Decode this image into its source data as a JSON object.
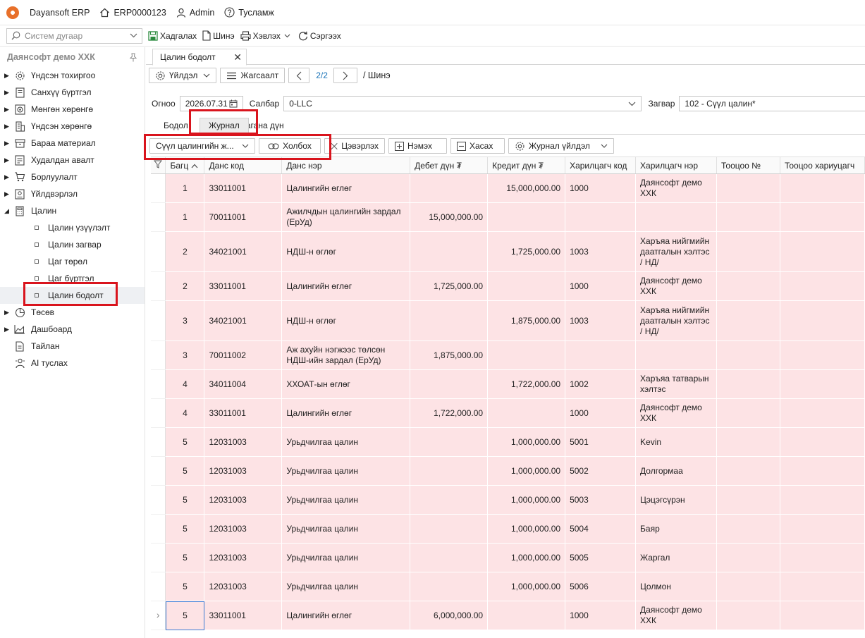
{
  "app": {
    "name": "Dayansoft ERP",
    "code": "ERP0000123",
    "user": "Admin",
    "help": "Тусламж"
  },
  "toolbar": {
    "search_placeholder": "Систем дугаар",
    "save": "Хадгалах",
    "new": "Шинэ",
    "print": "Хэвлэх",
    "refresh": "Сэргээх"
  },
  "sidebar": {
    "company": "Даянсофт демо ХХК",
    "items": [
      {
        "label": "Үндсэн тохиргоо",
        "icon": "gear-icon"
      },
      {
        "label": "Санхүү бүртгэл",
        "icon": "ledger-icon"
      },
      {
        "label": "Мөнгөн хөрөнгө",
        "icon": "cash-icon"
      },
      {
        "label": "Үндсэн хөрөнгө",
        "icon": "building-icon"
      },
      {
        "label": "Бараа материал",
        "icon": "box-icon"
      },
      {
        "label": "Худалдан авалт",
        "icon": "purchase-icon"
      },
      {
        "label": "Борлуулалт",
        "icon": "cart-icon"
      },
      {
        "label": "Үйлдвэрлэл",
        "icon": "factory-icon"
      },
      {
        "label": "Цалин",
        "icon": "calculator-icon"
      }
    ],
    "sub_items": [
      "Цалин үзүүлэлт",
      "Цалин загвар",
      "Цаг төрөл",
      "Цаг бүртгэл",
      "Цалин бодолт"
    ],
    "items_after": [
      {
        "label": "Төсөв",
        "icon": "pie-icon"
      },
      {
        "label": "Дашбоард",
        "icon": "chart-icon"
      },
      {
        "label": "Тайлан",
        "icon": "report-icon"
      },
      {
        "label": "AI туслах",
        "icon": "assistant-icon"
      }
    ]
  },
  "doc": {
    "tab": "Цалин бодолт",
    "action_btn": "Үйлдэл",
    "list_btn": "Жагсаалт",
    "pager": "2/2",
    "crumb": "/ Шинэ",
    "date_label": "Огноо",
    "date": "2026.07.31",
    "branch_label": "Салбар",
    "branch": "0-LLC",
    "template_label": "Загвар",
    "template": "102 - Сүүл цалин*"
  },
  "subtabs": {
    "calc": "Бодол",
    "journal": "Журнал",
    "columns": "Багана дүн"
  },
  "gridtools": {
    "journal_select": "Сүүл цалингийн ж...",
    "link": "Холбох",
    "clear": "Цэвэрлэх",
    "add": "Нэмэх",
    "remove": "Хасах",
    "journal_action": "Журнал үйлдэл"
  },
  "table": {
    "columns": [
      "Багц",
      "Данс код",
      "Данс нэр",
      "Дебет дүн ₮",
      "Кредит дүн ₮",
      "Харилцагч код",
      "Харилцагч нэр",
      "Тооцоо №",
      "Тооцоо хариуцагч"
    ],
    "rows": [
      {
        "batch": "1",
        "code": "33011001",
        "name": "Цалингийн өглөг",
        "debit": "",
        "credit": "15,000,000.00",
        "pcode": "1000",
        "pname": "Даянсофт демо ХХК",
        "h": 41
      },
      {
        "batch": "1",
        "code": "70011001",
        "name": "Ажилчдын цалингийн зардал (ЕрУд)",
        "debit": "15,000,000.00",
        "credit": "",
        "pcode": "",
        "pname": "",
        "h": 41
      },
      {
        "batch": "2",
        "code": "34021001",
        "name": "НДШ-н өглөг",
        "debit": "",
        "credit": "1,725,000.00",
        "pcode": "1003",
        "pname": "Харъяа нийгмийн даатгалын хэлтэс / НД/",
        "h": 57
      },
      {
        "batch": "2",
        "code": "33011001",
        "name": "Цалингийн өглөг",
        "debit": "1,725,000.00",
        "credit": "",
        "pcode": "1000",
        "pname": "Даянсофт демо ХХК",
        "h": 41
      },
      {
        "batch": "3",
        "code": "34021001",
        "name": "НДШ-н өглөг",
        "debit": "",
        "credit": "1,875,000.00",
        "pcode": "1003",
        "pname": "Харъяа нийгмийн даатгалын хэлтэс / НД/",
        "h": 57
      },
      {
        "batch": "3",
        "code": "70011002",
        "name": "Аж ахуйн нэгжээс төлсөн НДШ-ийн зардал (ЕрУд)",
        "debit": "1,875,000.00",
        "credit": "",
        "pcode": "",
        "pname": "",
        "h": 41
      },
      {
        "batch": "4",
        "code": "34011004",
        "name": "ХХОАТ-ын өглөг",
        "debit": "",
        "credit": "1,722,000.00",
        "pcode": "1002",
        "pname": "Харъяа татварын хэлтэс",
        "h": 41
      },
      {
        "batch": "4",
        "code": "33011001",
        "name": "Цалингийн өглөг",
        "debit": "1,722,000.00",
        "credit": "",
        "pcode": "1000",
        "pname": "Даянсофт демо ХХК",
        "h": 41
      },
      {
        "batch": "5",
        "code": "12031003",
        "name": "Урьдчилгаа цалин",
        "debit": "",
        "credit": "1,000,000.00",
        "pcode": "5001",
        "pname": "Kevin",
        "h": 41
      },
      {
        "batch": "5",
        "code": "12031003",
        "name": "Урьдчилгаа цалин",
        "debit": "",
        "credit": "1,000,000.00",
        "pcode": "5002",
        "pname": "Долгормаа",
        "h": 41
      },
      {
        "batch": "5",
        "code": "12031003",
        "name": "Урьдчилгаа цалин",
        "debit": "",
        "credit": "1,000,000.00",
        "pcode": "5003",
        "pname": "Цэцэгсүрэн",
        "h": 41
      },
      {
        "batch": "5",
        "code": "12031003",
        "name": "Урьдчилгаа цалин",
        "debit": "",
        "credit": "1,000,000.00",
        "pcode": "5004",
        "pname": "Баяр",
        "h": 41
      },
      {
        "batch": "5",
        "code": "12031003",
        "name": "Урьдчилгаа цалин",
        "debit": "",
        "credit": "1,000,000.00",
        "pcode": "5005",
        "pname": "Жаргал",
        "h": 41
      },
      {
        "batch": "5",
        "code": "12031003",
        "name": "Урьдчилгаа цалин",
        "debit": "",
        "credit": "1,000,000.00",
        "pcode": "5006",
        "pname": "Цолмон",
        "h": 41
      },
      {
        "batch": "5",
        "code": "33011001",
        "name": "Цалингийн өглөг",
        "debit": "6,000,000.00",
        "credit": "",
        "pcode": "1000",
        "pname": "Даянсофт демо ХХК",
        "h": 41
      }
    ]
  },
  "colors": {
    "row_bg": "#fde3e5",
    "highlight": "#d9141d",
    "accent": "#1a73b8"
  }
}
